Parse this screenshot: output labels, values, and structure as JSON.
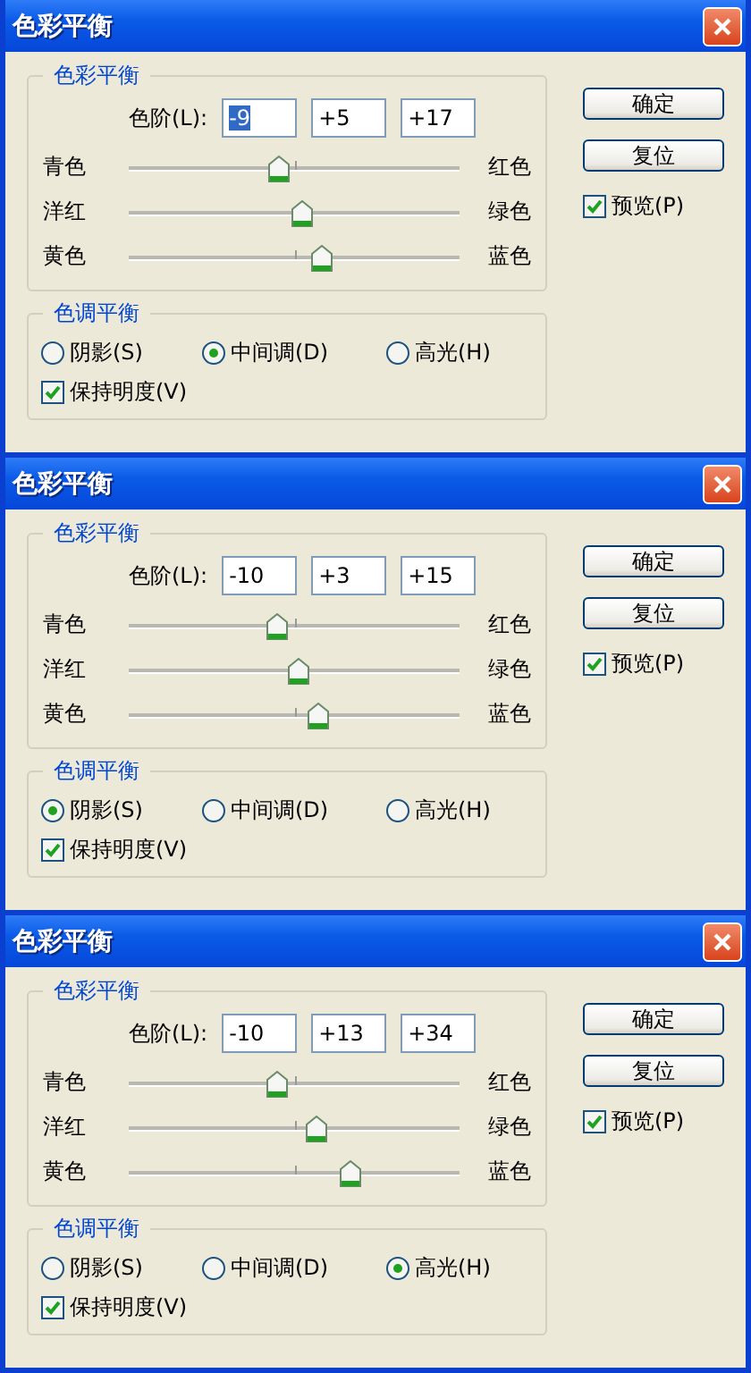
{
  "dialogs": [
    {
      "title": "色彩平衡",
      "color_balance": {
        "legend": "色彩平衡",
        "levels_label": "色阶(L):",
        "levels": [
          {
            "value": "-9",
            "highlighted": true
          },
          {
            "value": "+5",
            "highlighted": false
          },
          {
            "value": "+17",
            "highlighted": false
          }
        ],
        "sliders": [
          {
            "left": "青色",
            "right": "红色",
            "level": 0.455
          },
          {
            "left": "洋红",
            "right": "绿色",
            "level": 0.525
          },
          {
            "left": "黄色",
            "right": "蓝色",
            "level": 0.585
          }
        ]
      },
      "tone_balance": {
        "legend": "色调平衡",
        "options": [
          {
            "label": "阴影(S)",
            "selected": false
          },
          {
            "label": "中间调(D)",
            "selected": true
          },
          {
            "label": "高光(H)",
            "selected": false
          }
        ],
        "preserve_luminosity": {
          "label": "保持明度(V)",
          "checked": true
        }
      },
      "buttons": [
        "确定",
        "复位"
      ],
      "preview": {
        "label": "预览(P)",
        "checked": true
      }
    },
    {
      "title": "色彩平衡",
      "color_balance": {
        "legend": "色彩平衡",
        "levels_label": "色阶(L):",
        "levels": [
          {
            "value": "-10",
            "highlighted": false
          },
          {
            "value": "+3",
            "highlighted": false
          },
          {
            "value": "+15",
            "highlighted": false
          }
        ],
        "sliders": [
          {
            "left": "青色",
            "right": "红色",
            "level": 0.45
          },
          {
            "left": "洋红",
            "right": "绿色",
            "level": 0.515
          },
          {
            "left": "黄色",
            "right": "蓝色",
            "level": 0.575
          }
        ]
      },
      "tone_balance": {
        "legend": "色调平衡",
        "options": [
          {
            "label": "阴影(S)",
            "selected": true
          },
          {
            "label": "中间调(D)",
            "selected": false
          },
          {
            "label": "高光(H)",
            "selected": false
          }
        ],
        "preserve_luminosity": {
          "label": "保持明度(V)",
          "checked": true
        }
      },
      "buttons": [
        "确定",
        "复位"
      ],
      "preview": {
        "label": "预览(P)",
        "checked": true
      }
    },
    {
      "title": "色彩平衡",
      "color_balance": {
        "legend": "色彩平衡",
        "levels_label": "色阶(L):",
        "levels": [
          {
            "value": "-10",
            "highlighted": false
          },
          {
            "value": "+13",
            "highlighted": false
          },
          {
            "value": "+34",
            "highlighted": false
          }
        ],
        "sliders": [
          {
            "left": "青色",
            "right": "红色",
            "level": 0.45
          },
          {
            "left": "洋红",
            "right": "绿色",
            "level": 0.565
          },
          {
            "left": "黄色",
            "right": "蓝色",
            "level": 0.67
          }
        ]
      },
      "tone_balance": {
        "legend": "色调平衡",
        "options": [
          {
            "label": "阴影(S)",
            "selected": false
          },
          {
            "label": "中间调(D)",
            "selected": false
          },
          {
            "label": "高光(H)",
            "selected": true
          }
        ],
        "preserve_luminosity": {
          "label": "保持明度(V)",
          "checked": true
        }
      },
      "buttons": [
        "确定",
        "复位"
      ],
      "preview": {
        "label": "预览(P)",
        "checked": true
      }
    }
  ]
}
